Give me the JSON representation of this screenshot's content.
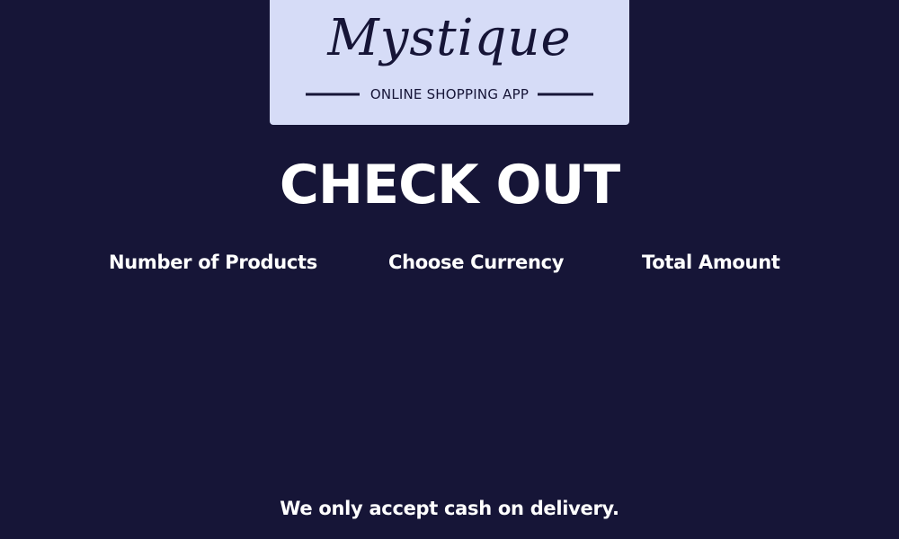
{
  "logo": {
    "script_text": "Mystique",
    "tagline": "ONLINE SHOPPING APP"
  },
  "page": {
    "title": "CHECK OUT"
  },
  "columns": {
    "products_label": "Number of Products",
    "currency_label": "Choose Currency",
    "total_label": "Total Amount"
  },
  "footer": {
    "note": "We only accept cash on delivery."
  },
  "colors": {
    "background": "#161537",
    "logo_card": "#d6dcf7",
    "text": "#ffffff",
    "logo_ink": "#161537"
  }
}
